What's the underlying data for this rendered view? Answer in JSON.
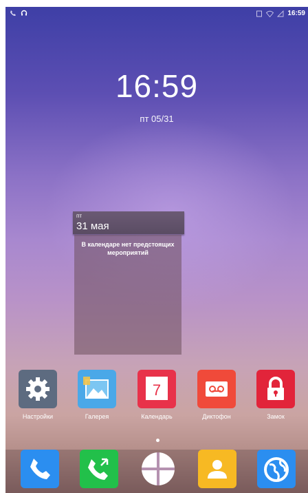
{
  "status_bar": {
    "left_icons": [
      "missed-call-icon",
      "headset-icon"
    ],
    "right_icons": [
      "sim-icon",
      "wifi-icon",
      "signal-icon"
    ],
    "time": "16:59"
  },
  "clock": {
    "time": "16:59",
    "date": "пт  05/31"
  },
  "calendar_widget": {
    "day_of_week": "пт",
    "date": "31 мая",
    "message": "В календаре нет предстоящих мероприятий"
  },
  "apps": [
    {
      "label": "Настройки",
      "icon": "settings-icon",
      "color": "#5d6b80"
    },
    {
      "label": "Галерея",
      "icon": "gallery-icon",
      "color": "#4aa8e8"
    },
    {
      "label": "Календарь",
      "icon": "calendar-icon",
      "color": "#e8324a",
      "badge": "7"
    },
    {
      "label": "Диктофон",
      "icon": "recorder-icon",
      "color": "#f04a3a"
    },
    {
      "label": "Замок",
      "icon": "lock-icon",
      "color": "#e2243a"
    }
  ],
  "dock": [
    {
      "icon": "phone-icon",
      "color": "#2b8ef0"
    },
    {
      "icon": "call-log-icon",
      "color": "#22c04a"
    },
    {
      "icon": "app-drawer-icon",
      "color": "#ffffff"
    },
    {
      "icon": "contacts-icon",
      "color": "#f7b923"
    },
    {
      "icon": "browser-icon",
      "color": "#2b8ef0"
    }
  ]
}
